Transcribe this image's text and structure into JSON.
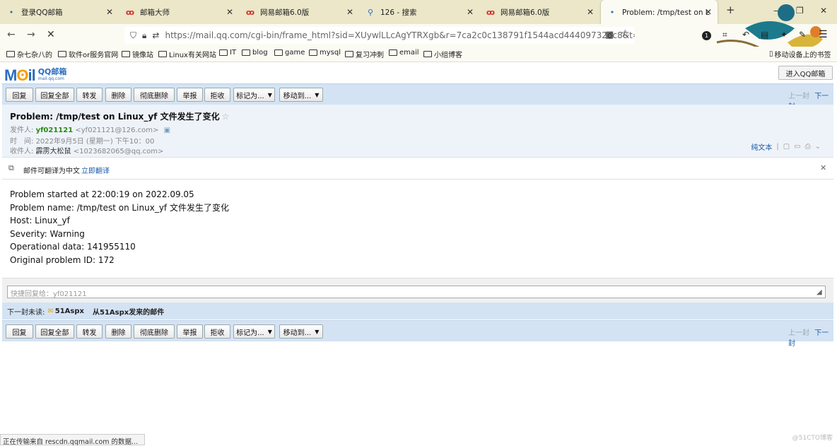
{
  "browser": {
    "tabs": [
      {
        "icon": "dot",
        "title": "登录QQ邮箱"
      },
      {
        "icon": "mail163",
        "title": "邮箱大师"
      },
      {
        "icon": "mail163",
        "title": "网易邮箱6.0版"
      },
      {
        "icon": "search",
        "title": "126 - 搜索"
      },
      {
        "icon": "mail163",
        "title": "网易邮箱6.0版"
      },
      {
        "icon": "dot",
        "title": "Problem: /tmp/test on Linux_yf 文件发生了变化"
      }
    ],
    "url": "https://mail.qq.com/cgi-bin/frame_html?sid=XUywlLLcAgYTRXgb&r=7ca2c0c138791f1544acd44409732dc8&t=neww",
    "url_host": "mail.qq.com",
    "bookmarks": [
      "杂七杂八的",
      "软件or服务官网",
      "镜像站",
      "Linux有关网站",
      "IT",
      "blog",
      "game",
      "mysql",
      "复习冲刺",
      "email",
      "小组博客"
    ],
    "mobile_bookmarks": "移动设备上的书签",
    "badge_count": "1",
    "status_text": "正在传输来自 rescdn.qqmail.com 的数据..."
  },
  "mail": {
    "logo_text": "QQ邮箱",
    "logo_domain": "mail.qq.com",
    "enter_button": "进入QQ邮箱",
    "toolbar": {
      "reply": "回复",
      "reply_all": "回复全部",
      "forward": "转发",
      "delete": "删除",
      "delete_permanent": "彻底删除",
      "report": "举报",
      "reject": "拒收",
      "mark_as": "标记为...",
      "move_to": "移动到...",
      "prev": "上一封",
      "next": "下一封"
    },
    "subject": "Problem: /tmp/test on Linux_yf 文件发生了变化",
    "from_label": "发件人:",
    "from_name": "yf021121",
    "from_email": "<yf021121@126.com>",
    "time_label": "时　间:",
    "time_value": "2022年9月5日 (星期一) 下午10：00",
    "to_label": "收件人:",
    "to_name": "霹雳大松鼠",
    "to_email": "<1023682065@qq.com>",
    "plain_text": "纯文本",
    "translate_hint": "邮件可翻译为中文",
    "translate_link": "立即翻译",
    "body_lines": [
      "Problem started at 22:00:19 on 2022.09.05",
      "Problem name: /tmp/test on Linux_yf 文件发生了变化",
      "Host: Linux_yf",
      "Severity: Warning",
      "Operational data: 141955110",
      "Original problem ID: 172"
    ],
    "quick_reply_placeholder": "快捷回复给：yf021121",
    "next_unread_label": "下一封未读:",
    "next_unread_sender": "51Aspx",
    "next_unread_subject": "从51Aspx发来的邮件"
  },
  "watermark": "@51CTO博客",
  "colors": {
    "toolbar_bg": "#d4e3f4",
    "link": "#1a5ca8",
    "sender_green": "#2a8a16",
    "tabbar": "#ebe7c8"
  }
}
